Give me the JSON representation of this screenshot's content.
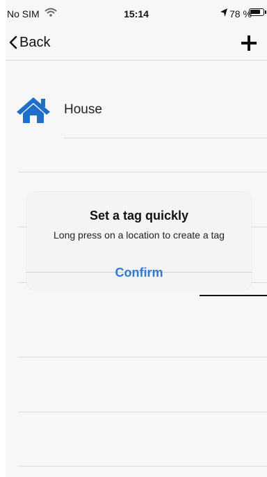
{
  "status_bar": {
    "carrier": "No SIM",
    "time": "15:14",
    "battery": "78 %",
    "battery_level": 0.78,
    "icons": [
      "wifi-icon",
      "location-arrow-icon",
      "battery-icon"
    ]
  },
  "nav": {
    "back_label": "Back",
    "add_icon": "plus-icon"
  },
  "list": {
    "items": [
      {
        "label": "House",
        "icon": "house-icon",
        "icon_color": "#1f6fc9"
      }
    ]
  },
  "alert": {
    "title": "Set a tag quickly",
    "message": "Long press on a location to create a tag",
    "confirm_label": "Confirm",
    "accent_color": "#2f7ad6"
  }
}
